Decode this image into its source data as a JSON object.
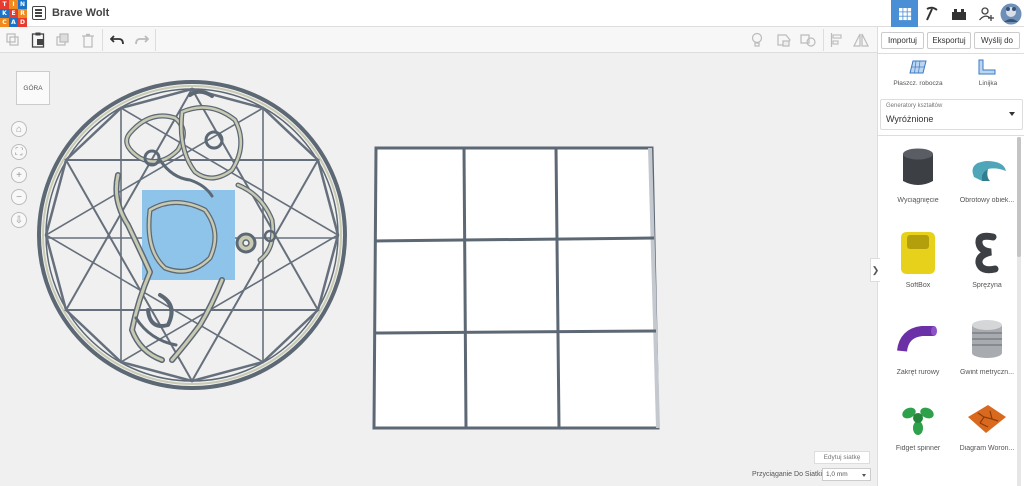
{
  "app": {
    "title": "Brave Wolt",
    "logo_letters": [
      "T",
      "I",
      "N",
      "K",
      "E",
      "R",
      "C",
      "A",
      "D"
    ],
    "logo_colors": [
      "#e63b2e",
      "#f08a1c",
      "#1a73c9",
      "#1a73c9",
      "#e63b2e",
      "#f08a1c",
      "#f08a1c",
      "#1a73c9",
      "#e63b2e"
    ]
  },
  "top_right": {
    "grid_view_icon": "grid-view-icon",
    "pickaxe_icon": "pickaxe-icon",
    "brick_icon": "brick-icon",
    "add_user_icon": "add-user-icon",
    "avatar_icon": "avatar-icon"
  },
  "toolbar": {
    "copy_icon": "copy-icon",
    "paste_icon": "paste-icon",
    "duplicate_icon": "duplicate-icon",
    "delete_icon": "delete-icon",
    "undo_icon": "undo-icon",
    "redo_icon": "redo-icon",
    "bulb_icon": "lightbulb-icon",
    "group_icon": "group-icon",
    "ungroup_icon": "ungroup-icon",
    "align_icon": "align-icon",
    "mirror_icon": "mirror-icon"
  },
  "right_panel": {
    "import_label": "Importuj",
    "export_label": "Eksportuj",
    "send_label": "Wyślij do",
    "workplane_label": "Płaszcz. robocza",
    "ruler_label": "Linijka",
    "generators_label": "Generatory kształtów",
    "generators_value": "Wyróżnione",
    "shapes": [
      {
        "label": "Wyciągnięcie",
        "color": "#3c3f44"
      },
      {
        "label": "Obrotowy obiek...",
        "color": "#4fa6b8"
      },
      {
        "label": "SoftBox",
        "color": "#e8d11a"
      },
      {
        "label": "Sprężyna",
        "color": "#3c3f44"
      },
      {
        "label": "Zakręt rurowy",
        "color": "#6b2fa6"
      },
      {
        "label": "Gwint metryczn...",
        "color": "#a8abaf"
      },
      {
        "label": "Fidget spinner",
        "color": "#2fa14a"
      },
      {
        "label": "Diagram Woron...",
        "color": "#d9691e"
      }
    ]
  },
  "viewport": {
    "view_cube_label": "GÓRA",
    "edit_grid_label": "Edytuj siatkę",
    "snap_label": "Przyciąganie Do Siatki",
    "snap_value": "1,0 mm",
    "collapse_symbol": "❯",
    "nav_symbols": [
      "⌂",
      "⛶",
      "+",
      "−",
      "⇩"
    ]
  }
}
